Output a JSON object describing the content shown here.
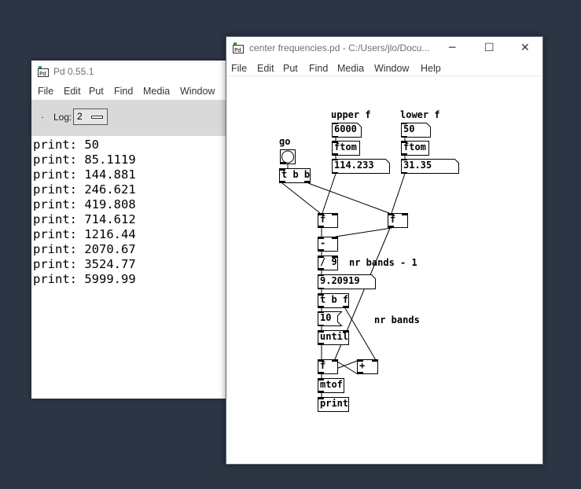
{
  "main_window": {
    "title": "Pd 0.55.1",
    "menu": [
      "File",
      "Edit",
      "Put",
      "Find",
      "Media",
      "Window"
    ],
    "log_label": "Log:",
    "log_level": "2",
    "console_lines": [
      "print: 50",
      "print: 85.1119",
      "print: 144.881",
      "print: 246.621",
      "print: 419.808",
      "print: 714.612",
      "print: 1216.44",
      "print: 2070.67",
      "print: 3524.77",
      "print: 5999.99"
    ]
  },
  "patch_window": {
    "title": "center frequencies.pd  - C:/Users/jlo/Docu...",
    "menu": [
      "File",
      "Edit",
      "Put",
      "Find",
      "Media",
      "Window",
      "Help"
    ],
    "controls": {
      "minimize": "─",
      "maximize": "☐",
      "close": "✕"
    },
    "comments": {
      "upper": "upper f",
      "lower": "lower f",
      "go": "go",
      "bands_minus": "nr bands - 1",
      "bands": "nr bands"
    },
    "atoms": {
      "upper_val": "6000",
      "lower_val": "50",
      "upper_midi": "114.233",
      "lower_midi": "31.35",
      "ratio": "9.20919",
      "nbands": "10"
    },
    "objects": {
      "ftom_upper": "ftom",
      "ftom_lower": "ftom",
      "tbb": "t b b",
      "f_left": "f",
      "f_right": "f",
      "minus": "-",
      "div": "/ 9",
      "tbf": "t b f",
      "until": "until",
      "f_acc": "f",
      "plus": "+",
      "mtof": "mtof",
      "print": "print"
    }
  }
}
